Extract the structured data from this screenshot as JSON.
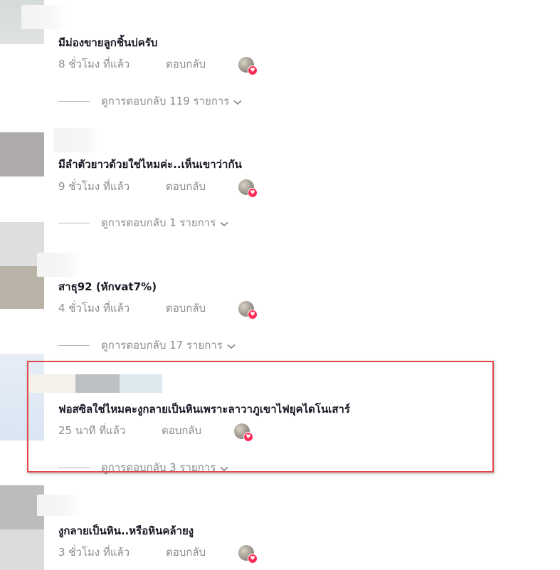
{
  "comments": [
    {
      "text": "มีม่องขายลูกชิ้นบ่ครับ",
      "time": "8 ชั่วโมง ที่แล้ว",
      "reply_label": "ตอบกลับ",
      "view_replies": "ดูการตอบกลับ 119 รายการ"
    },
    {
      "text": "มีลำตัวยาวด้วยใช่ไหมค่ะ..เห็นเขาว่ากัน",
      "time": "9 ชั่วโมง ที่แล้ว",
      "reply_label": "ตอบกลับ",
      "view_replies": "ดูการตอบกลับ 1 รายการ"
    },
    {
      "text": "สาธุ92 (หักvat7%)",
      "time": "4 ชั่วโมง ที่แล้ว",
      "reply_label": "ตอบกลับ",
      "view_replies": "ดูการตอบกลับ 17 รายการ"
    },
    {
      "text": "ฟอสซิลใช่ไหมคะงูกลายเป็นหินเพราะลาวาภูเขาไฟยุคไดโนเสาร์",
      "time": "25 นาที ที่แล้ว",
      "reply_label": "ตอบกลับ",
      "view_replies": "ดูการตอบกลับ 3 รายการ"
    },
    {
      "text": "งูกลายเป็นหิน..หรือหินคล้ายงู",
      "time": "3 ชั่วโมง ที่แล้ว",
      "reply_label": "ตอบกลับ"
    }
  ],
  "colors": {
    "highlight_border": "#e2484a",
    "meta_text": "#8a8b91",
    "heart": "#fe2c55"
  },
  "icons": {
    "creator_like": "creator-liked-avatar-icon",
    "heart": "heart-icon",
    "chevron": "chevron-down-icon"
  }
}
